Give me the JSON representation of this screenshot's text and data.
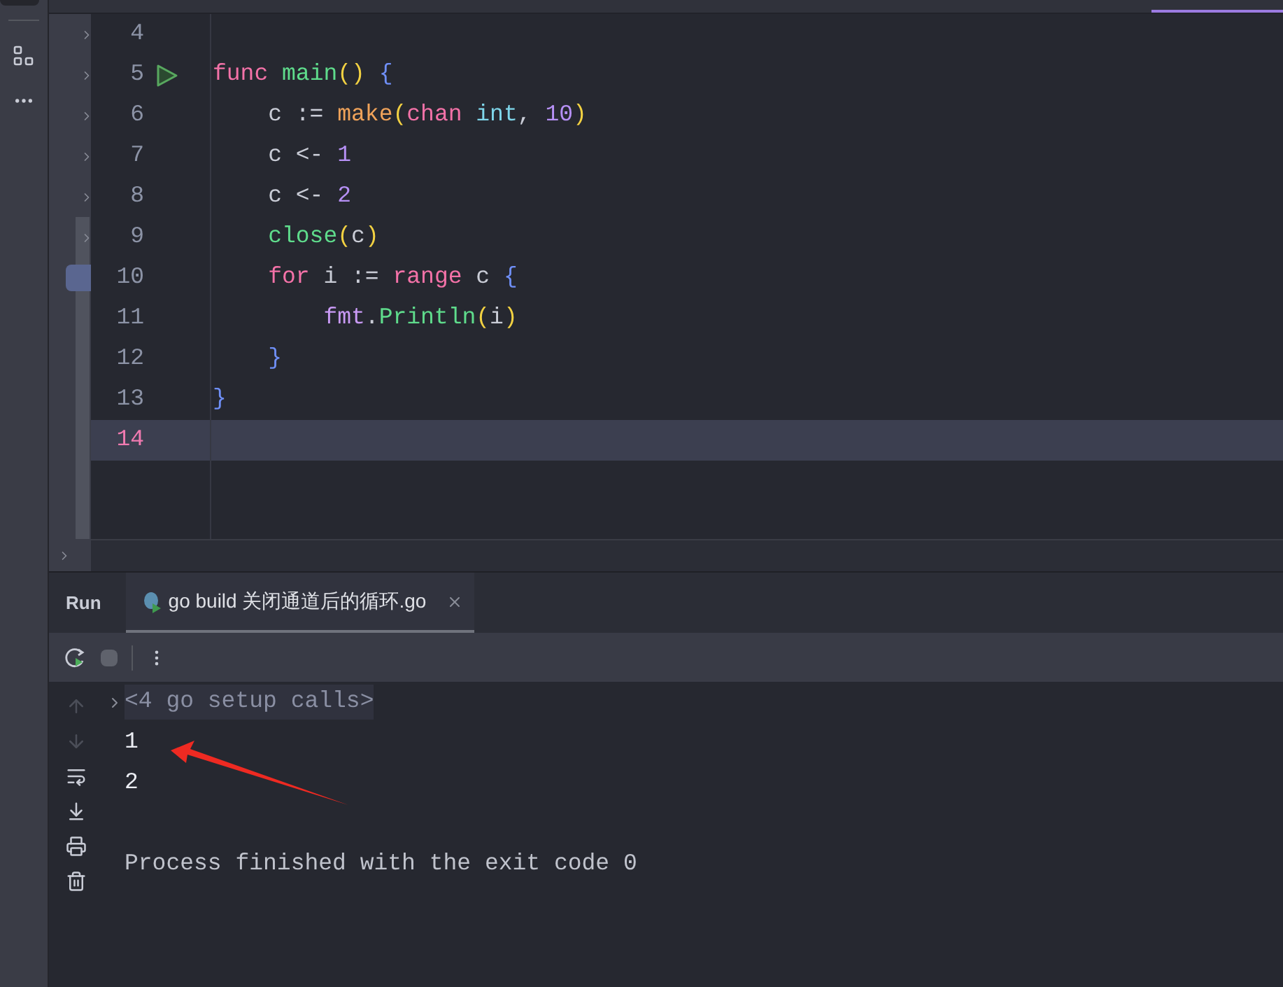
{
  "editor": {
    "lines": [
      {
        "number": "4",
        "selected": false,
        "run_icon": false
      },
      {
        "number": "5",
        "selected": false,
        "run_icon": true,
        "segments": [
          {
            "text": "func ",
            "color": "#f472a8"
          },
          {
            "text": "main",
            "color": "#5fdc8c"
          },
          {
            "text": "() ",
            "color": "#f2d142"
          },
          {
            "text": "{",
            "color": "#6f8ff7"
          }
        ]
      },
      {
        "number": "6",
        "selected": false,
        "run_icon": false,
        "segments": [
          {
            "text": "    c := ",
            "color": "#c9ccd6"
          },
          {
            "text": "make",
            "color": "#f0a35a"
          },
          {
            "text": "(",
            "color": "#f2d142"
          },
          {
            "text": "chan ",
            "color": "#f472a8"
          },
          {
            "text": "int",
            "color": "#7fd6ea"
          },
          {
            "text": ", ",
            "color": "#c9ccd6"
          },
          {
            "text": "10",
            "color": "#b690f5"
          },
          {
            "text": ")",
            "color": "#f2d142"
          }
        ]
      },
      {
        "number": "7",
        "selected": false,
        "run_icon": false,
        "segments": [
          {
            "text": "    c <- ",
            "color": "#c9ccd6"
          },
          {
            "text": "1",
            "color": "#b690f5"
          }
        ]
      },
      {
        "number": "8",
        "selected": false,
        "run_icon": false,
        "segments": [
          {
            "text": "    c <- ",
            "color": "#c9ccd6"
          },
          {
            "text": "2",
            "color": "#b690f5"
          }
        ]
      },
      {
        "number": "9",
        "selected": false,
        "run_icon": false,
        "segments": [
          {
            "text": "    close",
            "color": "#5fdc8c"
          },
          {
            "text": "(",
            "color": "#f2d142"
          },
          {
            "text": "c",
            "color": "#c9ccd6"
          },
          {
            "text": ")",
            "color": "#f2d142"
          }
        ]
      },
      {
        "number": "10",
        "selected": false,
        "run_icon": false,
        "segments": [
          {
            "text": "    for",
            "color": "#f472a8"
          },
          {
            "text": " i := ",
            "color": "#c9ccd6"
          },
          {
            "text": "range",
            "color": "#f472a8"
          },
          {
            "text": " c ",
            "color": "#c9ccd6"
          },
          {
            "text": "{",
            "color": "#6f8ff7"
          }
        ]
      },
      {
        "number": "11",
        "selected": false,
        "run_icon": false,
        "segments": [
          {
            "text": "        fmt",
            "color": "#c99af5"
          },
          {
            "text": ".",
            "color": "#c9ccd6"
          },
          {
            "text": "Println",
            "color": "#5fdc8c"
          },
          {
            "text": "(",
            "color": "#f2d142"
          },
          {
            "text": "i",
            "color": "#c9ccd6"
          },
          {
            "text": ")",
            "color": "#f2d142"
          }
        ]
      },
      {
        "number": "12",
        "selected": false,
        "run_icon": false,
        "segments": [
          {
            "text": "    }",
            "color": "#6f8ff7"
          }
        ]
      },
      {
        "number": "13",
        "selected": false,
        "run_icon": false,
        "segments": [
          {
            "text": "}",
            "color": "#6f8ff7"
          }
        ]
      },
      {
        "number": "14",
        "selected": true,
        "run_icon": false
      }
    ]
  },
  "run_panel": {
    "title": "Run",
    "tabs": [
      {
        "label": "go build 关闭通道后的循环.go",
        "selected": true
      }
    ],
    "console": [
      {
        "kind": "folded",
        "text": "<4 go setup calls>"
      },
      {
        "kind": "output",
        "text": "1"
      },
      {
        "kind": "output",
        "text": "2"
      },
      {
        "kind": "system",
        "text": "Process finished with the exit code 0"
      }
    ]
  }
}
